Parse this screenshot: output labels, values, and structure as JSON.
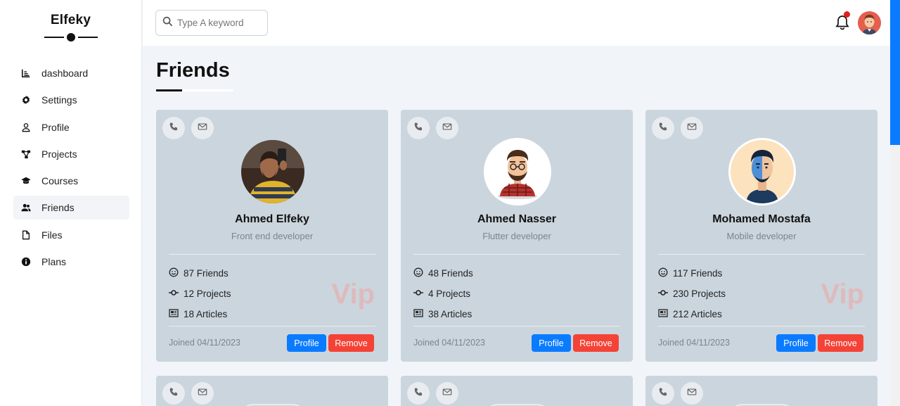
{
  "brand": "Elfeky",
  "sidebar": {
    "items": [
      {
        "label": "dashboard",
        "icon": "chart-icon"
      },
      {
        "label": "Settings",
        "icon": "gear-icon"
      },
      {
        "label": "Profile",
        "icon": "user-icon"
      },
      {
        "label": "Projects",
        "icon": "diagram-icon"
      },
      {
        "label": "Courses",
        "icon": "graduation-cap-icon"
      },
      {
        "label": "Friends",
        "icon": "users-icon",
        "active": true
      },
      {
        "label": "Files",
        "icon": "file-icon"
      },
      {
        "label": "Plans",
        "icon": "info-icon"
      }
    ]
  },
  "header": {
    "search_placeholder": "Type A keyword",
    "notification_dot_color": "#e11d1d"
  },
  "page": {
    "title": "Friends"
  },
  "colors": {
    "accent": "#0a7bff",
    "danger": "#f44336",
    "card_bg": "#cbd5dd",
    "vip": "#e3b4b4"
  },
  "friends": [
    {
      "name": "Ahmed Elfeky",
      "role": "Front end developer",
      "friends": "87 Friends",
      "projects": "12 Projects",
      "articles": "18 Articles",
      "vip": "Vip",
      "joined": "Joined 04/11/2023",
      "profile_label": "Profile",
      "remove_label": "Remove"
    },
    {
      "name": "Ahmed Nasser",
      "role": "Flutter developer",
      "friends": "48 Friends",
      "projects": "4 Projects",
      "articles": "38 Articles",
      "joined": "Joined 04/11/2023",
      "profile_label": "Profile",
      "remove_label": "Remove"
    },
    {
      "name": "Mohamed Mostafa",
      "role": "Mobile developer",
      "friends": "117 Friends",
      "projects": "230 Projects",
      "articles": "212 Articles",
      "vip": "Vip",
      "joined": "Joined 04/11/2023",
      "profile_label": "Profile",
      "remove_label": "Remove"
    }
  ]
}
